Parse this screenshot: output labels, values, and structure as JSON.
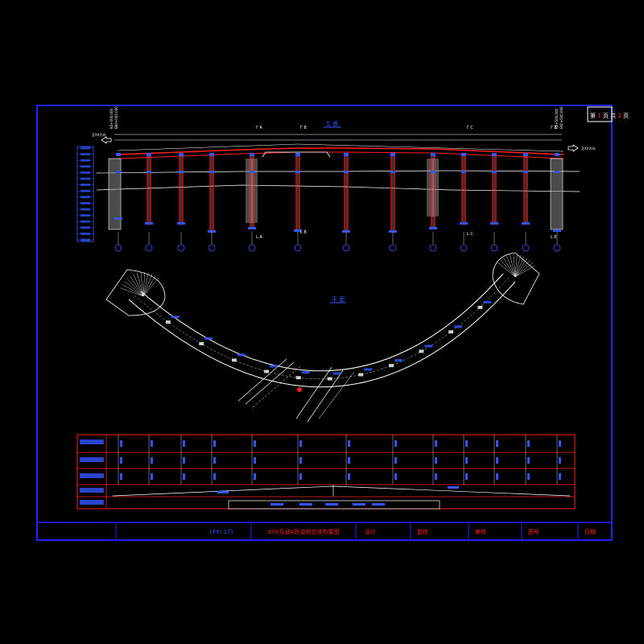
{
  "sheet": {
    "page_label_prefix": "第",
    "page_current": "1",
    "page_mid": "页 共",
    "page_total": "2",
    "page_suffix": "页"
  },
  "elevation": {
    "title": "立 面",
    "section_marks": [
      "Γ A",
      "Γ B",
      "Γ C",
      "Γ E"
    ],
    "bottom_marks": [
      "L A",
      "L B",
      "L C",
      "L E"
    ],
    "left_label": "至XX方向",
    "right_label": "至XX方向"
  },
  "plan": {
    "title": "平 面"
  },
  "title_block": {
    "code": "(XX) 17)",
    "drawing_title": "XXX互通A匝道桥总体布置图",
    "design_label": "设计",
    "review_label": "复核",
    "approve_label": "审核",
    "drawing_no_label": "图号",
    "date_label": "日期"
  },
  "colors": {
    "frame": "#2222ff",
    "girder": "#ff2020",
    "pier": "#ff2020",
    "grid": "#ffffff",
    "table_border": "#ff2020",
    "text_blue": "#3355ff"
  }
}
